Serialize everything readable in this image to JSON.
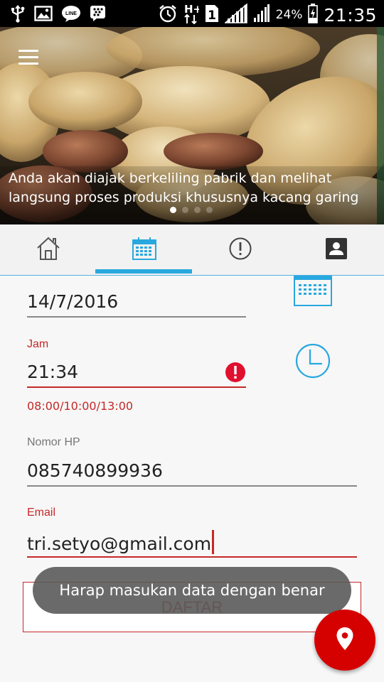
{
  "status_bar": {
    "battery": "24%",
    "time": "21:35",
    "left_icons": [
      "usb-icon",
      "gallery-icon",
      "line-app-icon",
      "bbm-icon"
    ],
    "right_icons": [
      "alarm-icon",
      "hplus-data-icon",
      "sim-1-icon",
      "signal-icon",
      "signal-2-icon",
      "battery-charging-icon"
    ]
  },
  "hero": {
    "caption": "Anda akan diajak berkeliling pabrik dan melihat langsung proses produksi khususnya kacang garing",
    "dots_total": 4,
    "active_dot": 1
  },
  "tabs": [
    {
      "name": "home",
      "icon": "home-icon"
    },
    {
      "name": "schedule",
      "icon": "calendar-icon",
      "active": true
    },
    {
      "name": "info",
      "icon": "info-icon"
    },
    {
      "name": "contact",
      "icon": "contact-card-icon"
    }
  ],
  "form": {
    "date": {
      "value": "14/7/2016"
    },
    "time": {
      "label": "Jam",
      "value": "21:34",
      "helper": "08:00/10:00/13:00"
    },
    "phone": {
      "label": "Nomor HP",
      "value": "085740899936"
    },
    "email": {
      "label": "Email",
      "value": "tri.setyo@gmail.com"
    },
    "submit_label": "DAFTAR"
  },
  "toast": "Harap masukan data dengan benar",
  "fab_icon": "location-pin-icon",
  "colors": {
    "accent_blue": "#29a8df",
    "error_red": "#c62828",
    "fab_red": "#d50000"
  }
}
